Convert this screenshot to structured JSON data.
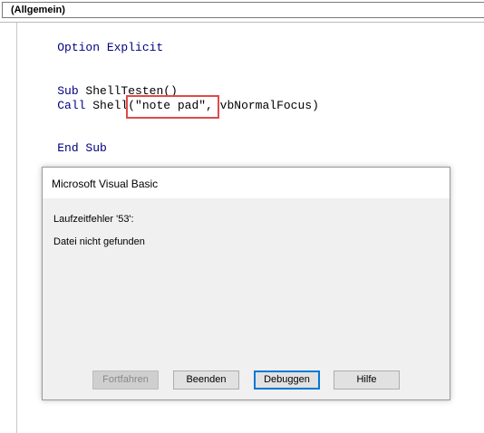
{
  "header": {
    "object_combo": "(Allgemein)"
  },
  "code": {
    "line1_kw": "Option Explicit",
    "line2_kw": "Sub",
    "line2_rest": " ShellTesten()",
    "line3_kw": "Call",
    "line3_rest": " Shell(\"note pad\", vbNormalFocus)",
    "line4_kw": "End Sub"
  },
  "dialog": {
    "title": "Microsoft Visual Basic",
    "error_code_text": "Laufzeitfehler '53':",
    "error_message": "Datei nicht gefunden",
    "buttons": {
      "continue": "Fortfahren",
      "end": "Beenden",
      "debug": "Debuggen",
      "help": "Hilfe"
    }
  },
  "colors": {
    "keyword": "#000080",
    "highlight_border": "#e04a4a",
    "default_button_border": "#0078d7"
  }
}
